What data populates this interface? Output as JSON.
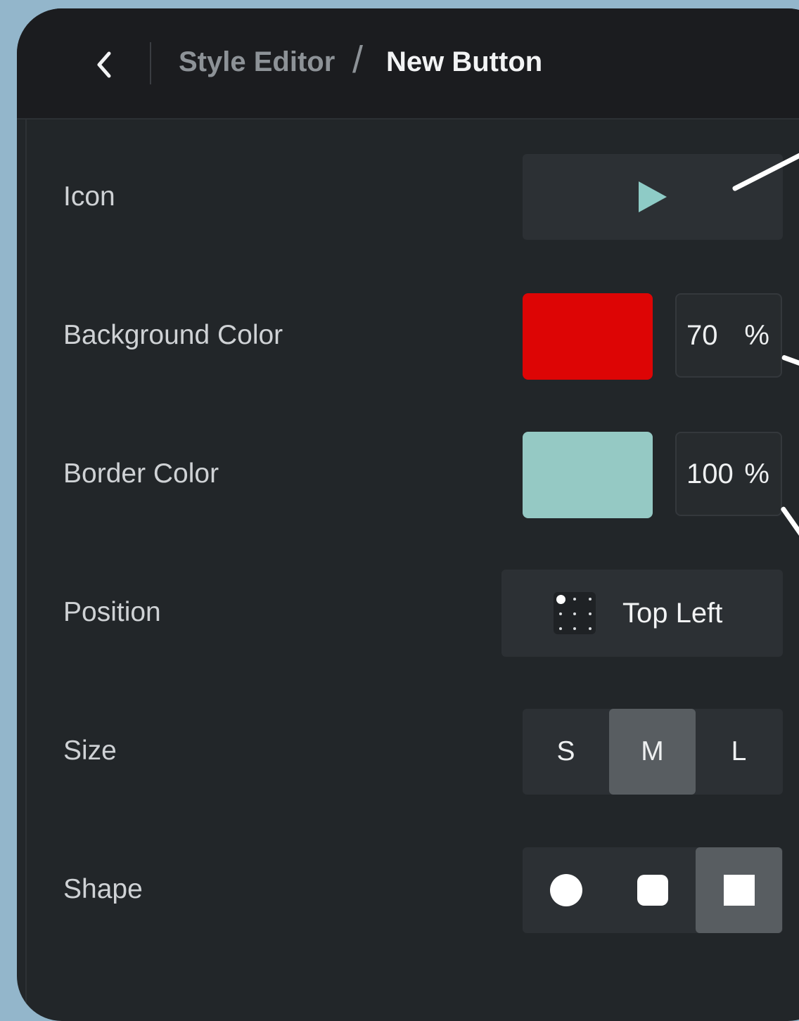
{
  "header": {
    "back_icon": "chevron-left-icon",
    "breadcrumb_parent": "Style Editor",
    "breadcrumb_separator": "/",
    "title": "New Button"
  },
  "rows": {
    "icon": {
      "label": "Icon",
      "value_icon": "play-icon",
      "icon_color": "#8ecbc6"
    },
    "background_color": {
      "label": "Background Color",
      "color": "#dd0505",
      "opacity": "70",
      "unit": "%"
    },
    "border_color": {
      "label": "Border Color",
      "color": "#95c9c4",
      "opacity": "100",
      "unit": "%"
    },
    "position": {
      "label": "Position",
      "value": "Top Left",
      "icon": "position-grid-icon"
    },
    "size": {
      "label": "Size",
      "options": [
        "S",
        "M",
        "L"
      ],
      "selected": "M"
    },
    "shape": {
      "label": "Shape",
      "options": [
        "circle-shape-icon",
        "rounded-square-shape-icon",
        "square-shape-icon"
      ],
      "selected": "square-shape-icon"
    }
  }
}
